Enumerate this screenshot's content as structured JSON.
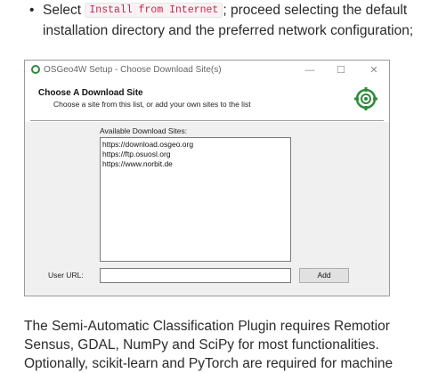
{
  "bullet": {
    "prefix": "Select",
    "code": "Install from Internet",
    "suffix": "; proceed selecting the default",
    "line2": "installation directory and the preferred network configuration;"
  },
  "window": {
    "title": "OSGeo4W Setup - Choose Download Site(s)",
    "controls": {
      "minimize": "—",
      "maximize": "☐",
      "close": "✕"
    },
    "header_title": "Choose A Download Site",
    "header_subtitle": "Choose a site from this list, or add your own sites to the list",
    "list_label": "Available Download Sites:",
    "sites": [
      "https://download.osgeo.org",
      "https://ftp.osuosl.org",
      "https://www.norbit.de"
    ],
    "user_url_label": "User URL:",
    "user_url_value": "",
    "add_button": "Add",
    "logo_icon": "osgeo-logo-icon",
    "accent_color": "#2e8b3a"
  },
  "paragraph": {
    "line1": "The Semi-Automatic Classification Plugin requires Remotior",
    "line2": "Sensus, GDAL, NumPy and SciPy for most functionalities.",
    "line3": "Optionally, scikit-learn and PyTorch are required for machine"
  }
}
